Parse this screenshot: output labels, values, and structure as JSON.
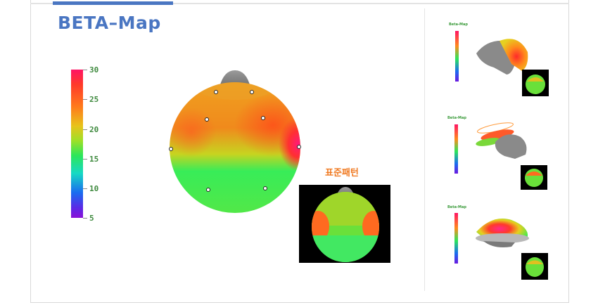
{
  "title": "BETA–Map",
  "scale": {
    "labels": [
      "30",
      "25",
      "20",
      "15",
      "10",
      "5"
    ],
    "colors": {
      "max": "#ff1464",
      "mid": "#2ce65a",
      "min": "#8a10d8"
    }
  },
  "standard_pattern_label": "표준패턴",
  "thumbnails": {
    "small_titles": [
      "Beta-Map",
      "Beta-Map",
      "Beta-Map"
    ]
  },
  "accent_color": "#4a76c2",
  "label_color": "#f07a22"
}
